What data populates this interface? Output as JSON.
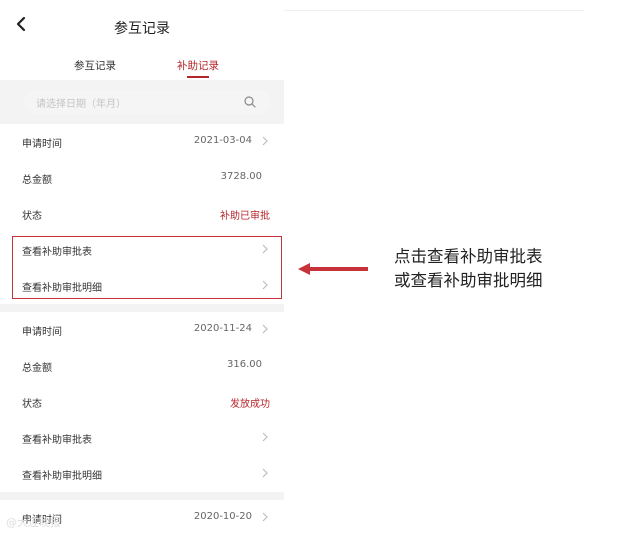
{
  "header": {
    "title": "参互记录"
  },
  "tabs": [
    {
      "label": "参互记录",
      "active": false
    },
    {
      "label": "补助记录",
      "active": true
    }
  ],
  "search": {
    "placeholder": "请选择日期（年月）"
  },
  "records": [
    {
      "apply_time_label": "申请时间",
      "apply_time": "2021-03-04",
      "total_label": "总金额",
      "total": "3728.00",
      "status_label": "状态",
      "status": "补助已审批",
      "view_approval_form": "查看补助审批表",
      "view_approval_detail": "查看补助审批明细"
    },
    {
      "apply_time_label": "申请时间",
      "apply_time": "2020-11-24",
      "total_label": "总金额",
      "total": "316.00",
      "status_label": "状态",
      "status": "发放成功",
      "view_approval_form": "查看补助审批表",
      "view_approval_detail": "查看补助审批明细"
    },
    {
      "apply_time_label": "申请时间",
      "apply_time": "2020-10-20"
    }
  ],
  "annotation": {
    "line1": "点击查看补助审批表",
    "line2": "或查看补助审批明细",
    "color": "#c7323a"
  },
  "watermark": "@大连晚报",
  "colors": {
    "accent": "#b5252c",
    "background": "#f3f3f3"
  }
}
